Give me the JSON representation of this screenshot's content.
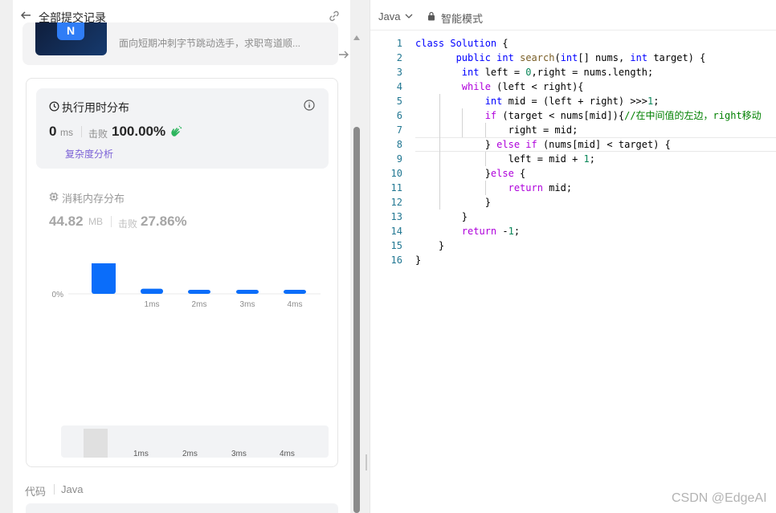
{
  "header": {
    "title": "全部提交记录"
  },
  "banner": {
    "text": "面向短期冲刺字节跳动选手，求职弯道顺...",
    "logo": "N"
  },
  "runtime": {
    "title": "执行用时分布",
    "value": "0",
    "unit": "ms",
    "beat_label": "击败",
    "beat_value": "100.00%",
    "complexity_link": "复杂度分析"
  },
  "memory": {
    "title": "消耗内存分布",
    "value": "44.82",
    "unit": "MB",
    "beat_label": "击败",
    "beat_value": "27.86%"
  },
  "chart_data": {
    "type": "bar",
    "categories": [
      "",
      "1ms",
      "2ms",
      "3ms",
      "4ms"
    ],
    "values": [
      93,
      4,
      2,
      2,
      2
    ],
    "ylim": [
      0,
      100
    ],
    "y_ticks": [
      "0%",
      "50%",
      "100%"
    ],
    "grid": true,
    "bar_color": "#0a6dfa"
  },
  "nav_labels": [
    "1ms",
    "2ms",
    "3ms",
    "4ms"
  ],
  "code_section": {
    "label": "代码",
    "lang": "Java"
  },
  "editor": {
    "language": "Java",
    "mode": "智能模式",
    "lines": [
      {
        "n": "1",
        "segs": [
          [
            "kw",
            "class"
          ],
          [
            "tx",
            " "
          ],
          [
            "ty",
            "Solution"
          ],
          [
            "tx",
            " {"
          ]
        ]
      },
      {
        "n": "2",
        "segs": [
          [
            "tx",
            "       "
          ],
          [
            "kw",
            "public"
          ],
          [
            "tx",
            " "
          ],
          [
            "ty",
            "int"
          ],
          [
            "tx",
            " "
          ],
          [
            "fn",
            "search"
          ],
          [
            "tx",
            "("
          ],
          [
            "ty",
            "int"
          ],
          [
            "tx",
            "[] nums, "
          ],
          [
            "ty",
            "int"
          ],
          [
            "tx",
            " target) {"
          ]
        ]
      },
      {
        "n": "3",
        "segs": [
          [
            "tx",
            "        "
          ],
          [
            "ty",
            "int"
          ],
          [
            "tx",
            " left = "
          ],
          [
            "nm",
            "0"
          ],
          [
            "tx",
            ",right = nums.length;"
          ]
        ]
      },
      {
        "n": "4",
        "segs": [
          [
            "tx",
            "        "
          ],
          [
            "kw2",
            "while"
          ],
          [
            "tx",
            " (left < right){"
          ]
        ]
      },
      {
        "n": "5",
        "segs": [
          [
            "tx",
            "            "
          ],
          [
            "ty",
            "int"
          ],
          [
            "tx",
            " mid = (left + right) >>>"
          ],
          [
            "nm",
            "1"
          ],
          [
            "tx",
            ";"
          ]
        ]
      },
      {
        "n": "6",
        "segs": [
          [
            "tx",
            "            "
          ],
          [
            "kw2",
            "if"
          ],
          [
            "tx",
            " (target < nums[mid]){"
          ],
          [
            "cm",
            "//在中间值的左边，right移动"
          ]
        ]
      },
      {
        "n": "7",
        "segs": [
          [
            "tx",
            "                right = mid;"
          ]
        ]
      },
      {
        "n": "8",
        "segs": [
          [
            "tx",
            "            } "
          ],
          [
            "kw2",
            "else if"
          ],
          [
            "tx",
            " (nums[mid] < target) {"
          ]
        ]
      },
      {
        "n": "9",
        "segs": [
          [
            "tx",
            "                left = mid + "
          ],
          [
            "nm",
            "1"
          ],
          [
            "tx",
            ";"
          ]
        ]
      },
      {
        "n": "10",
        "segs": [
          [
            "tx",
            "            }"
          ],
          [
            "kw2",
            "else"
          ],
          [
            "tx",
            " {"
          ]
        ]
      },
      {
        "n": "11",
        "segs": [
          [
            "tx",
            "                "
          ],
          [
            "kw2",
            "return"
          ],
          [
            "tx",
            " mid;"
          ]
        ]
      },
      {
        "n": "12",
        "segs": [
          [
            "tx",
            "            }"
          ]
        ]
      },
      {
        "n": "13",
        "segs": [
          [
            "tx",
            "        }"
          ]
        ]
      },
      {
        "n": "14",
        "segs": [
          [
            "tx",
            "        "
          ],
          [
            "kw2",
            "return"
          ],
          [
            "tx",
            " -"
          ],
          [
            "nm",
            "1"
          ],
          [
            "tx",
            ";"
          ]
        ]
      },
      {
        "n": "15",
        "segs": [
          [
            "tx",
            "    }"
          ]
        ]
      },
      {
        "n": "16",
        "segs": [
          [
            "tx",
            "}"
          ]
        ]
      }
    ]
  },
  "colors": {
    "kw": "#0000ff",
    "kw2": "#af00db",
    "ty": "#0000ff",
    "fn": "#795e26",
    "nm": "#098658",
    "cm": "#008000",
    "tx": "#000000"
  },
  "watermark": "CSDN @EdgeAI"
}
